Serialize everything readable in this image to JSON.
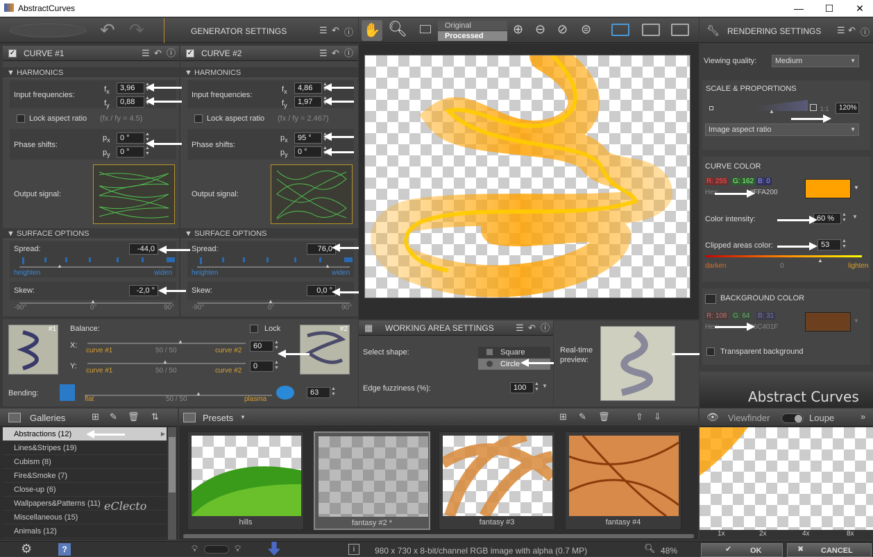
{
  "window": {
    "title": "AbstractCurves",
    "minimize": "—",
    "maximize": "☐",
    "close": "✕"
  },
  "generator": {
    "title": "GENERATOR SETTINGS"
  },
  "curves": [
    {
      "title": "CURVE #1",
      "harmonics": "HARMONICS",
      "input_freq_label": "Input frequencies:",
      "fx": "3,96",
      "fy": "0,88",
      "lock_label": "Lock aspect ratio",
      "ratio": "(fx / fy = 4.5)",
      "phase_label": "Phase shifts:",
      "px": "0 °",
      "py": "0 °",
      "output_label": "Output signal:",
      "surface": "SURFACE OPTIONS",
      "spread_label": "Spread:",
      "spread": "-44,0",
      "heighten": "heighten",
      "widen": "widen",
      "skew_label": "Skew:",
      "skew": "-2,0 °",
      "min": "-90°",
      "mid": "0°",
      "max": "90°"
    },
    {
      "title": "CURVE #2",
      "harmonics": "HARMONICS",
      "input_freq_label": "Input frequencies:",
      "fx": "4,86",
      "fy": "1,97",
      "lock_label": "Lock aspect ratio",
      "ratio": "(fx / fy = 2.467)",
      "phase_label": "Phase shifts:",
      "px": "95 °",
      "py": "0 °",
      "output_label": "Output signal:",
      "surface": "SURFACE OPTIONS",
      "spread_label": "Spread:",
      "spread": "76,0",
      "heighten": "heighten",
      "widen": "widen",
      "skew_label": "Skew:",
      "skew": "0,0 °",
      "min": "-90°",
      "mid": "0°",
      "max": "90°"
    }
  ],
  "balance": {
    "label": "Balance:",
    "lock": "Lock",
    "x_label": "X:",
    "y_label": "Y:",
    "curve1": "curve #1",
    "curve2": "curve #2",
    "ratio": "50 / 50",
    "x_val": "60",
    "y_val": "0",
    "badge1": "#1",
    "badge2": "#2"
  },
  "bending": {
    "label": "Bending:",
    "flat": "flat",
    "plasma": "plasma",
    "ratio": "50 / 50",
    "val": "63"
  },
  "view": {
    "original": "Original",
    "processed": "Processed"
  },
  "working": {
    "title": "WORKING AREA SETTINGS",
    "shape_label": "Select shape:",
    "square": "Square",
    "circle": "Circle",
    "fuzz_label": "Edge fuzziness (%):",
    "fuzz": "100",
    "preview_label": "Real-time preview:"
  },
  "rendering": {
    "title": "RENDERING SETTINGS",
    "quality_label": "Viewing quality:",
    "quality": "Medium",
    "scale_title": "SCALE & PROPORTIONS",
    "one": "1:1",
    "zoom": "120%",
    "aspect": "Image aspect ratio",
    "curve_color_title": "CURVE COLOR",
    "r": "R: 255",
    "g": "G: 162",
    "b": "B:   0",
    "hex_label": "Hex:",
    "hex": "#FFA200",
    "curve_color": "#FFA200",
    "intensity_label": "Color intensity:",
    "intensity": "60 %",
    "clipped_label": "Clipped areas color:",
    "clipped": "53",
    "darken": "darken",
    "zero": "0",
    "lighten": "lighten",
    "bg_title": "BACKGROUND COLOR",
    "bg_r": "R: 108",
    "bg_g": "G:  64",
    "bg_b": "B:  31",
    "bg_hex": "#6C401F",
    "bg_color": "#6C401F",
    "transparent": "Transparent background",
    "logo": "Abstract Curves"
  },
  "galleries": {
    "title": "Galleries",
    "items": [
      "Abstractions (12)",
      "Lines&Stripes (19)",
      "Cubism (8)",
      "Fire&Smoke (7)",
      "Close-up (6)",
      "Wallpapers&Patterns (11)",
      "Miscellaneous (15)",
      "Animals (12)"
    ],
    "watermark": "eClecto"
  },
  "presets": {
    "title": "Presets",
    "items": [
      "hills",
      "fantasy #2 *",
      "fantasy #3",
      "fantasy #4"
    ]
  },
  "viewfinder": {
    "label": "Viewfinder",
    "loupe": "Loupe",
    "zooms": [
      "1x",
      "2x",
      "4x",
      "8x"
    ]
  },
  "status": {
    "info": "980 x 730 x 8-bit/channel RGB image with alpha  (0.7 MP)",
    "zoom": "48%",
    "ok": "OK",
    "cancel": "CANCEL"
  }
}
